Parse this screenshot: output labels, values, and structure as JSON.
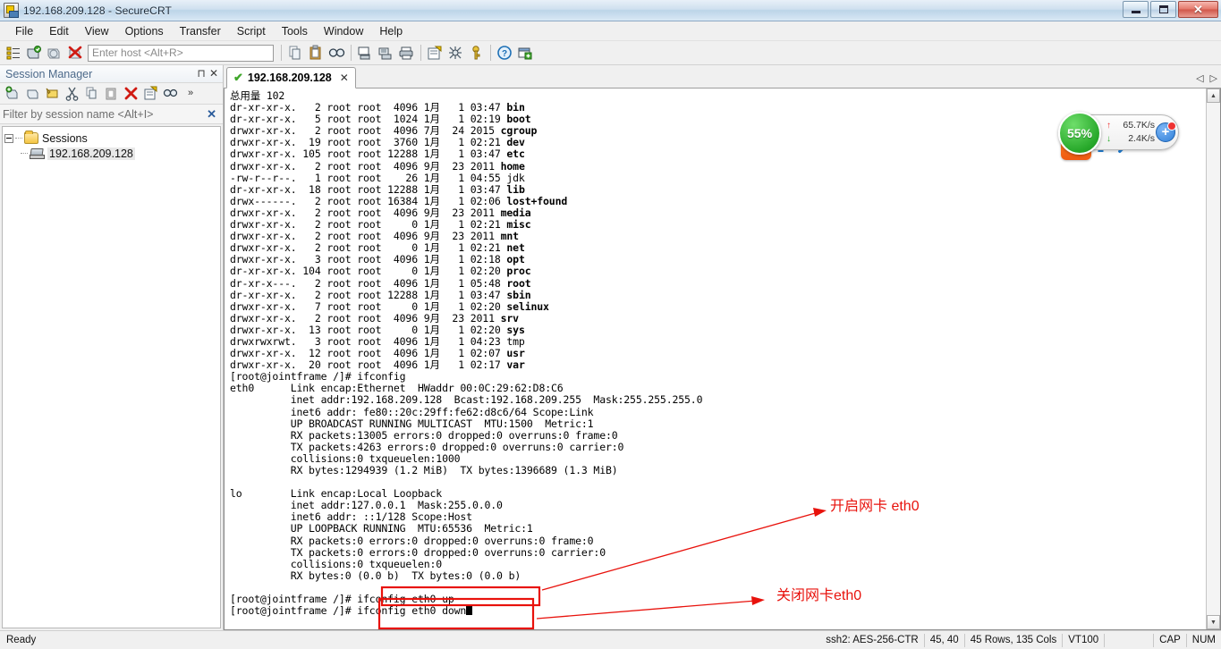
{
  "window": {
    "title": "192.168.209.128 - SecureCRT",
    "icon": "securecrt-icon",
    "minimize": "–",
    "maximize": "❐",
    "close": "✕"
  },
  "menubar": {
    "items": [
      "File",
      "Edit",
      "View",
      "Options",
      "Transfer",
      "Script",
      "Tools",
      "Window",
      "Help"
    ]
  },
  "toolbar": {
    "host_placeholder": "Enter host <Alt+R>",
    "icons_left": [
      "session-manager-icon",
      "connect-icon",
      "connect-sftp-icon",
      "disconnect-icon"
    ],
    "icons_right": [
      "copy-icon",
      "paste-icon",
      "find-icon",
      "print-screen-icon",
      "log-session-icon",
      "print-icon",
      "session-options-icon",
      "global-options-icon",
      "key-icon",
      "help-icon",
      "new-window-icon"
    ]
  },
  "sidebar": {
    "title": "Session Manager",
    "pin_glyph": "⊓",
    "close_glyph": "✕",
    "toolbar_icons": [
      "new-session-icon",
      "new-folder-icon",
      "connect-session-icon",
      "cut-icon",
      "copy-icon",
      "paste-icon",
      "delete-icon",
      "properties-icon",
      "find-icon",
      "overflow-icon"
    ],
    "overflow_glyph": "»",
    "filter_placeholder": "Filter by session name <Alt+I>",
    "filter_clear": "✕",
    "tree": {
      "root_label": "Sessions",
      "expander": "-",
      "children": [
        {
          "label": "192.168.209.128",
          "selected": true
        }
      ]
    }
  },
  "tabs": {
    "items": [
      {
        "label": "192.168.209.128",
        "status_icon": "connected-check-icon",
        "check": "✔",
        "close": "✕",
        "active": true
      }
    ],
    "scroll_left": "◁",
    "scroll_right": "▷"
  },
  "terminal": {
    "scroll_up_glyph": "▲",
    "scroll_down_glyph": "▼",
    "lines": [
      {
        "text": "总用量 102"
      },
      {
        "text": "dr-xr-xr-x.   2 root root  4096 1月   1 03:47 ",
        "bold": "bin"
      },
      {
        "text": "dr-xr-xr-x.   5 root root  1024 1月   1 02:19 ",
        "bold": "boot"
      },
      {
        "text": "drwxr-xr-x.   2 root root  4096 7月  24 2015 ",
        "bold": "cgroup"
      },
      {
        "text": "drwxr-xr-x.  19 root root  3760 1月   1 02:21 ",
        "bold": "dev"
      },
      {
        "text": "drwxr-xr-x. 105 root root 12288 1月   1 03:47 ",
        "bold": "etc"
      },
      {
        "text": "drwxr-xr-x.   2 root root  4096 9月  23 2011 ",
        "bold": "home"
      },
      {
        "text": "-rw-r--r--.   1 root root    26 1月   1 04:55 jdk"
      },
      {
        "text": "dr-xr-xr-x.  18 root root 12288 1月   1 03:47 ",
        "bold": "lib"
      },
      {
        "text": "drwx------.   2 root root 16384 1月   1 02:06 ",
        "bold": "lost+found"
      },
      {
        "text": "drwxr-xr-x.   2 root root  4096 9月  23 2011 ",
        "bold": "media"
      },
      {
        "text": "drwxr-xr-x.   2 root root     0 1月   1 02:21 ",
        "bold": "misc"
      },
      {
        "text": "drwxr-xr-x.   2 root root  4096 9月  23 2011 ",
        "bold": "mnt"
      },
      {
        "text": "drwxr-xr-x.   2 root root     0 1月   1 02:21 ",
        "bold": "net"
      },
      {
        "text": "drwxr-xr-x.   3 root root  4096 1月   1 02:18 ",
        "bold": "opt"
      },
      {
        "text": "dr-xr-xr-x. 104 root root     0 1月   1 02:20 ",
        "bold": "proc"
      },
      {
        "text": "dr-xr-x---.   2 root root  4096 1月   1 05:48 ",
        "bold": "root"
      },
      {
        "text": "dr-xr-xr-x.   2 root root 12288 1月   1 03:47 ",
        "bold": "sbin"
      },
      {
        "text": "drwxr-xr-x.   7 root root     0 1月   1 02:20 ",
        "bold": "selinux"
      },
      {
        "text": "drwxr-xr-x.   2 root root  4096 9月  23 2011 ",
        "bold": "srv"
      },
      {
        "text": "drwxr-xr-x.  13 root root     0 1月   1 02:20 ",
        "bold": "sys"
      },
      {
        "text": "drwxrwxrwt.   3 root root  4096 1月   1 04:23 tmp"
      },
      {
        "text": "drwxr-xr-x.  12 root root  4096 1月   1 02:07 ",
        "bold": "usr"
      },
      {
        "text": "drwxr-xr-x.  20 root root  4096 1月   1 02:17 ",
        "bold": "var"
      },
      {
        "text": "[root@jointframe /]# ifconfig"
      },
      {
        "text": "eth0      Link encap:Ethernet  HWaddr 00:0C:29:62:D8:C6"
      },
      {
        "text": "          inet addr:192.168.209.128  Bcast:192.168.209.255  Mask:255.255.255.0"
      },
      {
        "text": "          inet6 addr: fe80::20c:29ff:fe62:d8c6/64 Scope:Link"
      },
      {
        "text": "          UP BROADCAST RUNNING MULTICAST  MTU:1500  Metric:1"
      },
      {
        "text": "          RX packets:13005 errors:0 dropped:0 overruns:0 frame:0"
      },
      {
        "text": "          TX packets:4263 errors:0 dropped:0 overruns:0 carrier:0"
      },
      {
        "text": "          collisions:0 txqueuelen:1000"
      },
      {
        "text": "          RX bytes:1294939 (1.2 MiB)  TX bytes:1396689 (1.3 MiB)"
      },
      {
        "text": ""
      },
      {
        "text": "lo        Link encap:Local Loopback"
      },
      {
        "text": "          inet addr:127.0.0.1  Mask:255.0.0.0"
      },
      {
        "text": "          inet6 addr: ::1/128 Scope:Host"
      },
      {
        "text": "          UP LOOPBACK RUNNING  MTU:65536  Metric:1"
      },
      {
        "text": "          RX packets:0 errors:0 dropped:0 overruns:0 frame:0"
      },
      {
        "text": "          TX packets:0 errors:0 dropped:0 overruns:0 carrier:0"
      },
      {
        "text": "          collisions:0 txqueuelen:0"
      },
      {
        "text": "          RX bytes:0 (0.0 b)  TX bytes:0 (0.0 b)"
      },
      {
        "text": ""
      },
      {
        "text": "[root@jointframe /]# ifconfig eth0 up"
      },
      {
        "text": "[root@jointframe /]# ifconfig eth0 down"
      }
    ]
  },
  "annotations": {
    "color": "#e8120c",
    "items": [
      {
        "name": "annotation-enable-eth0",
        "text": "开启网卡 eth0"
      },
      {
        "name": "annotation-disable-eth0",
        "text": "关闭网卡eth0"
      }
    ]
  },
  "float_widget": {
    "percent": "55%",
    "upload_rate": "65.7K/s",
    "download_rate": "2.4K/s",
    "upload_arrow": "↑",
    "download_arrow": "↓",
    "plus": "+",
    "logo": "S"
  },
  "statusbar": {
    "ready": "Ready",
    "protocol": "ssh2: AES-256-CTR",
    "cursor": "45, 40",
    "dimensions": "45 Rows, 135 Cols",
    "emulation": "VT100",
    "cap": "CAP",
    "num": "NUM"
  }
}
